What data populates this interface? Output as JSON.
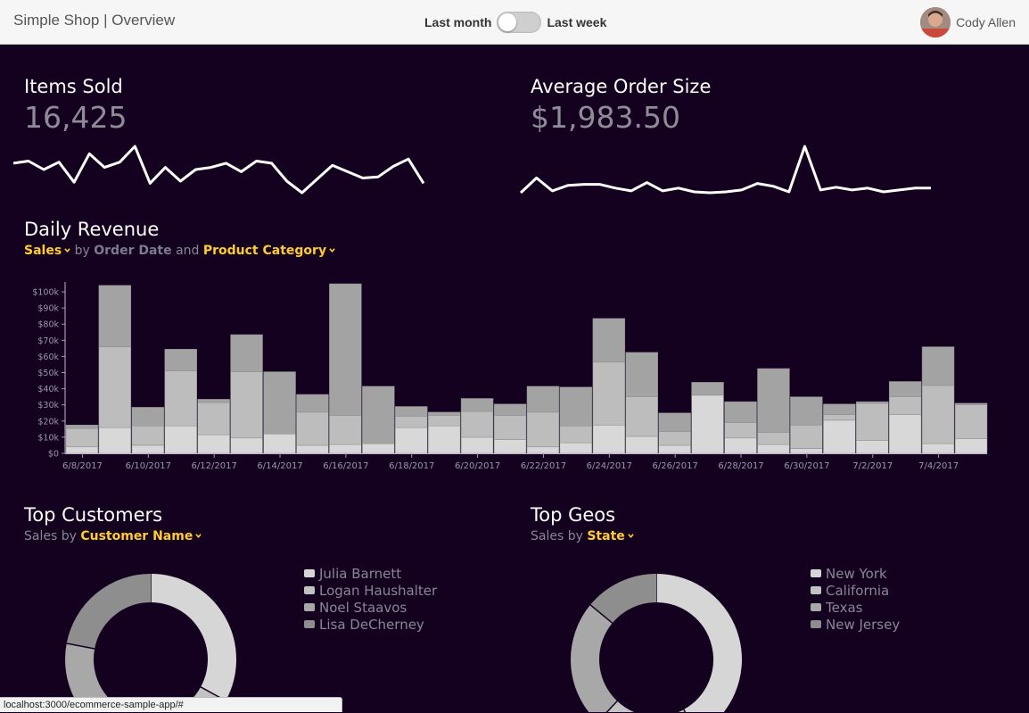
{
  "header": {
    "title": "Simple Shop | Overview",
    "toggle_left": "Last month",
    "toggle_right": "Last week",
    "user_name": "Cody Allen"
  },
  "items_sold": {
    "title": "Items Sold",
    "value": "16,425"
  },
  "avg_order": {
    "title": "Average Order Size",
    "value": "$1,983.50"
  },
  "daily_revenue": {
    "title": "Daily Revenue",
    "metric": "Sales",
    "by": "by",
    "dimension": "Order Date",
    "and": "and",
    "group": "Product Category"
  },
  "top_customers": {
    "title": "Top Customers",
    "metric": "Sales",
    "by": "by",
    "dimension": "Customer Name",
    "legend": [
      "Julia Barnett",
      "Logan Haushalter",
      "Noel Staavos",
      "Lisa DeCherney"
    ]
  },
  "top_geos": {
    "title": "Top Geos",
    "metric": "Sales",
    "by": "by",
    "dimension": "State",
    "legend": [
      "New York",
      "California",
      "Texas",
      "New Jersey"
    ]
  },
  "status_url": "localhost:3000/ecommerce-sample-app/#",
  "colors": {
    "background": "#14001f",
    "accent": "#ffcd2c",
    "seg_light": "#d6d6d6",
    "seg_mid": "#bcbcbc",
    "seg_dark": "#a4a4a4"
  },
  "chart_data": [
    {
      "type": "line",
      "title": "Items Sold",
      "values": [
        560,
        580,
        500,
        570,
        380,
        650,
        520,
        570,
        720,
        370,
        520,
        390,
        500,
        520,
        560,
        480,
        580,
        560,
        390,
        280,
        410,
        540,
        480,
        420,
        430,
        530,
        600,
        370
      ]
    },
    {
      "type": "line",
      "title": "Average Order Size",
      "values": [
        1600,
        2400,
        1700,
        2000,
        2050,
        2050,
        1850,
        1700,
        2150,
        1700,
        1850,
        1650,
        1600,
        1650,
        1750,
        2100,
        1950,
        1650,
        4100,
        1750,
        1900,
        1750,
        1850,
        1650,
        1750,
        1850,
        1850
      ]
    },
    {
      "type": "bar",
      "title": "Daily Revenue",
      "stacked": true,
      "categories": [
        "6/8/2017",
        "6/9/2017",
        "6/10/2017",
        "6/11/2017",
        "6/12/2017",
        "6/13/2017",
        "6/14/2017",
        "6/15/2017",
        "6/16/2017",
        "6/17/2017",
        "6/18/2017",
        "6/19/2017",
        "6/20/2017",
        "6/21/2017",
        "6/22/2017",
        "6/23/2017",
        "6/24/2017",
        "6/25/2017",
        "6/26/2017",
        "6/27/2017",
        "6/28/2017",
        "6/29/2017",
        "6/30/2017",
        "7/1/2017",
        "7/2/2017",
        "7/3/2017",
        "7/4/2017",
        "7/5/2017"
      ],
      "x_tick_labels": [
        "6/8/2017",
        "6/10/2017",
        "6/12/2017",
        "6/14/2017",
        "6/16/2017",
        "6/18/2017",
        "6/20/2017",
        "6/22/2017",
        "6/24/2017",
        "6/26/2017",
        "6/28/2017",
        "6/30/2017",
        "7/2/2017",
        "7/4/2017"
      ],
      "y_tick_labels": [
        "$0",
        "$10k",
        "$20k",
        "$30k",
        "$40k",
        "$50k",
        "$60k",
        "$70k",
        "$80k",
        "$90k",
        "$100k"
      ],
      "ylim": [
        0,
        105000
      ],
      "series": [
        {
          "values": [
            4000,
            16000,
            5000,
            17000,
            11500,
            9500,
            12000,
            5000,
            5500,
            6000,
            16000,
            17000,
            10000,
            8500,
            4000,
            6500,
            17500,
            10500,
            5000,
            36000,
            9500,
            5500,
            3000,
            20500,
            8000,
            24000,
            6000,
            9000
          ]
        },
        {
          "values": [
            11500,
            50000,
            12000,
            34000,
            20000,
            41000,
            0,
            20500,
            18000,
            0,
            7000,
            6500,
            16000,
            15000,
            21500,
            10500,
            39000,
            24500,
            8500,
            0,
            9500,
            7500,
            14500,
            3500,
            23000,
            11000,
            36000,
            21000
          ]
        },
        {
          "values": [
            2000,
            38000,
            11500,
            13500,
            2000,
            23000,
            38500,
            11000,
            81500,
            35500,
            6000,
            2000,
            8000,
            7000,
            16000,
            24000,
            27000,
            27500,
            11500,
            8000,
            13000,
            39500,
            17500,
            6500,
            1000,
            9500,
            24000,
            1000
          ]
        }
      ]
    },
    {
      "type": "pie",
      "title": "Top Customers",
      "labels": [
        "Julia Barnett",
        "Logan Haushalter",
        "Noel Staavos",
        "Lisa DeCherney"
      ],
      "values": [
        33,
        22,
        23,
        22
      ]
    },
    {
      "type": "pie",
      "title": "Top Geos",
      "labels": [
        "New York",
        "California",
        "Texas",
        "New Jersey"
      ],
      "values": [
        42,
        20,
        24,
        14
      ]
    }
  ]
}
